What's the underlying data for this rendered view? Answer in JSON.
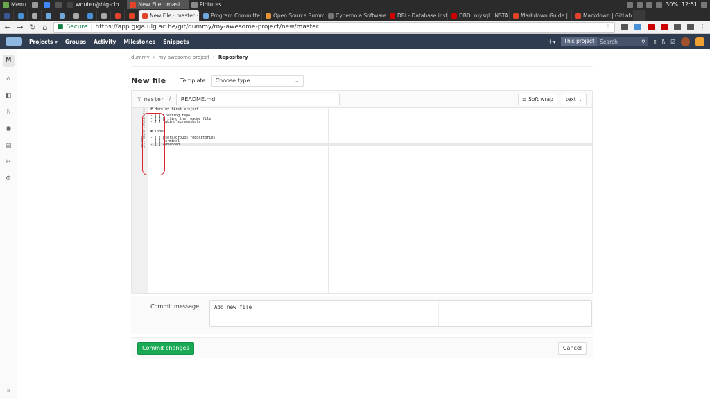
{
  "taskbar": {
    "menu_label": "Menu",
    "terminal_title": "wouter@big-clo...",
    "browser_title": "New File · mast...",
    "folder_title": "Pictures",
    "battery": "30%",
    "clock": "12:51"
  },
  "browser": {
    "tabs": [
      {
        "label": "New File · master · ...",
        "active": true
      },
      {
        "label": "Program Committe..."
      },
      {
        "label": "Open Source Summ..."
      },
      {
        "label": "Cybernoia Software..."
      },
      {
        "label": "DBI - Database inst..."
      },
      {
        "label": "DBD::mysql::INSTA..."
      },
      {
        "label": "Markdown Guide | ..."
      },
      {
        "label": "Markdown | GitLab"
      }
    ],
    "secure_label": "Secure",
    "url": "https://app.giga.ulg.ac.be/git/dummy/my-awesome-project/new/master"
  },
  "gitlab_nav": {
    "items": [
      "Projects",
      "Groups",
      "Activity",
      "Milestones",
      "Snippets"
    ],
    "search_scope": "This project",
    "search_placeholder": "Search"
  },
  "sidebar": {
    "project_letter": "M"
  },
  "breadcrumb": [
    "dummy",
    "my-awesome-project",
    "Repository"
  ],
  "page": {
    "title": "New file",
    "template_label": "Template",
    "template_value": "Choose type"
  },
  "editor": {
    "branch": "master",
    "separator": "/",
    "filename": "README.md",
    "soft_wrap_label": "Soft wrap",
    "mode_label": "text",
    "lines": [
      "# Here my first project",
      "",
      "- [ ] Creating repo",
      "- [ ] Writing the readme file",
      "- [ ] Taking screenshots",
      "",
      "",
      "# Todos",
      "",
      "- [ ] Users/groups repositories",
      "- [ ] Terminal",
      "- [ ] Advanced",
      ""
    ]
  },
  "commit": {
    "label": "Commit message",
    "message": "Add new file",
    "submit_label": "Commit changes",
    "cancel_label": "Cancel"
  }
}
